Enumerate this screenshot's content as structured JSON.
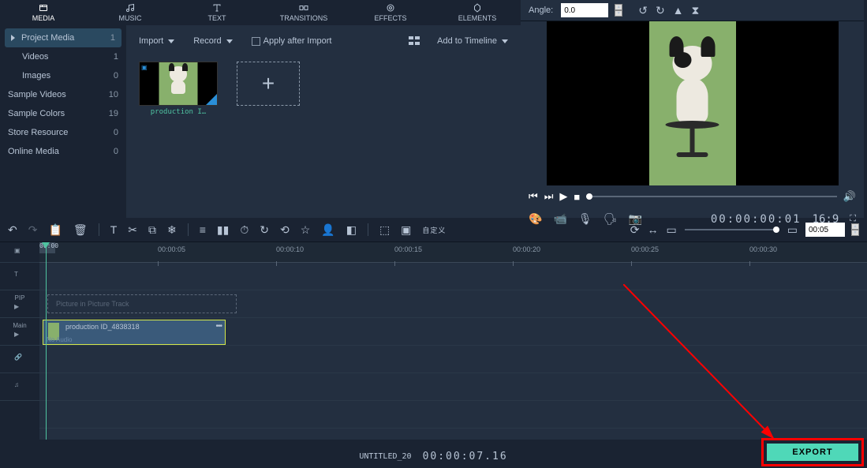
{
  "tabs": {
    "media": "MEDIA",
    "music": "MUSIC",
    "text": "TEXT",
    "transitions": "TRANSITIONS",
    "effects": "EFFECTS",
    "elements": "ELEMENTS"
  },
  "sidebar": {
    "items": [
      {
        "label": "Project Media",
        "count": "1",
        "active": true
      },
      {
        "label": "Videos",
        "count": "1"
      },
      {
        "label": "Images",
        "count": "0"
      },
      {
        "label": "Sample Videos",
        "count": "10"
      },
      {
        "label": "Sample Colors",
        "count": "19"
      },
      {
        "label": "Store Resource",
        "count": "0"
      },
      {
        "label": "Online Media",
        "count": "0"
      }
    ]
  },
  "mid": {
    "import": "Import",
    "record": "Record",
    "apply_after": "Apply after Import",
    "add_timeline": "Add to Timeline",
    "thumb_name": "production I…"
  },
  "preview": {
    "angle_label": "Angle:",
    "angle_value": "0.0",
    "timecode": "00:00:00:01",
    "aspect": "16:9",
    "duration_box": "00:05"
  },
  "toolbar": {
    "custom": "自定义"
  },
  "timeline": {
    "ruler": [
      "00:00",
      "00:00:05",
      "00:00:10",
      "00:00:15",
      "00:00:20",
      "00:00:25",
      "00:00:30"
    ],
    "pip_placeholder": "Picture in Picture Track",
    "pip_label": "PIP",
    "main_label": "Main",
    "clip_name": "production ID_4838318",
    "no_audio": "No Audio"
  },
  "bottom": {
    "project": "UNTITLED_20",
    "timecode": "00:00:07.16",
    "export": "EXPORT"
  }
}
